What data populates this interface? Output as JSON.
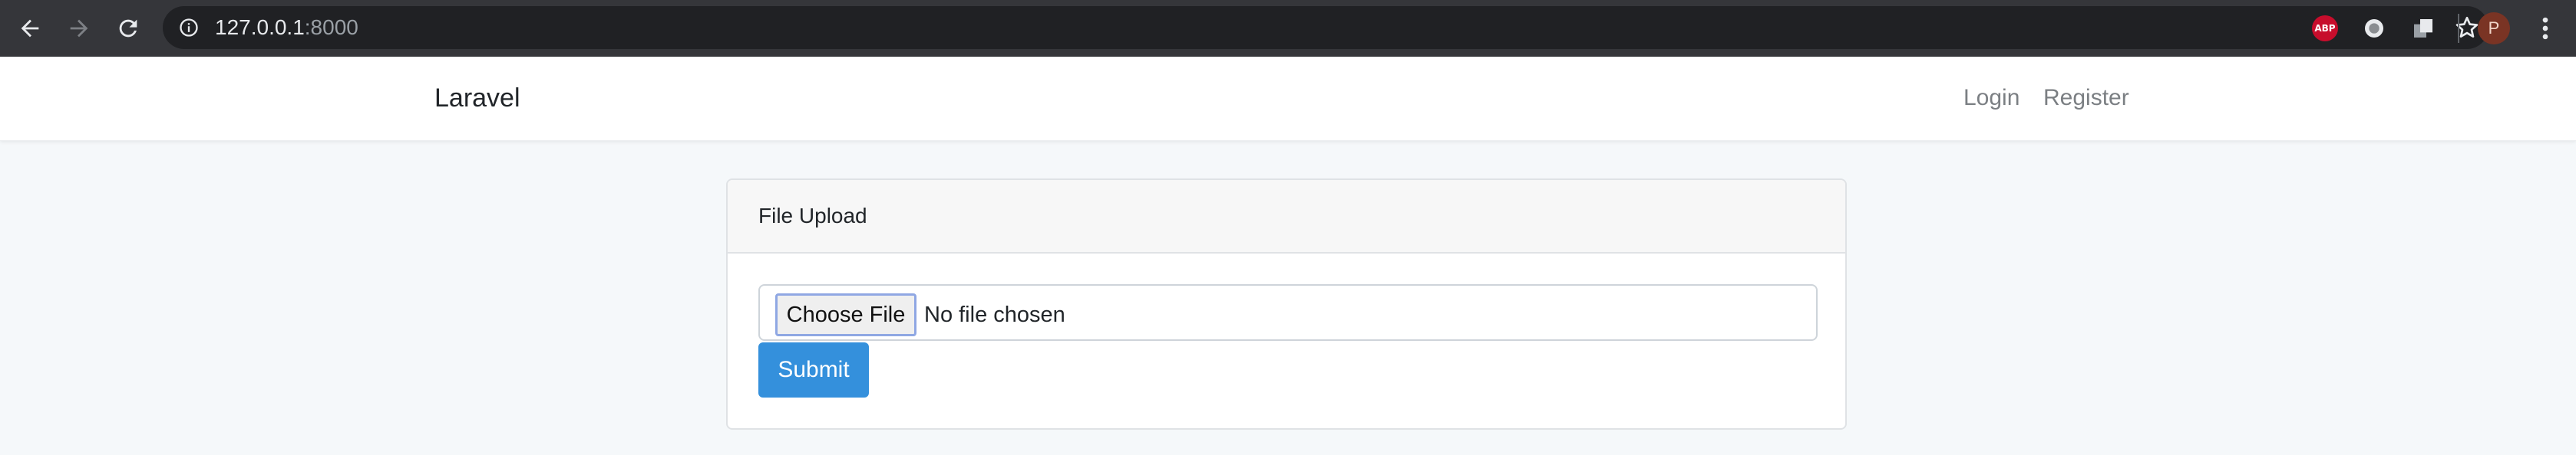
{
  "browser": {
    "url_host": "127.0.0.1",
    "url_port": ":8000",
    "icons": {
      "back": "back-arrow-icon",
      "forward": "forward-arrow-icon",
      "reload": "reload-icon",
      "info": "info-icon",
      "bookmark": "star-icon",
      "menu": "kebab-menu-icon"
    },
    "extensions": {
      "abp_label": "ABP"
    },
    "profile_initial": "P"
  },
  "navbar": {
    "brand": "Laravel",
    "links": [
      {
        "label": "Login"
      },
      {
        "label": "Register"
      }
    ]
  },
  "card": {
    "header": "File Upload",
    "file_input": {
      "button_label": "Choose File",
      "status_text": "No file chosen"
    },
    "submit_label": "Submit"
  },
  "colors": {
    "chrome_bg": "#35363a",
    "page_bg": "#f5f8fa",
    "primary": "#3490dc",
    "brand_text": "#212529",
    "nav_link": "#7b7f83"
  }
}
